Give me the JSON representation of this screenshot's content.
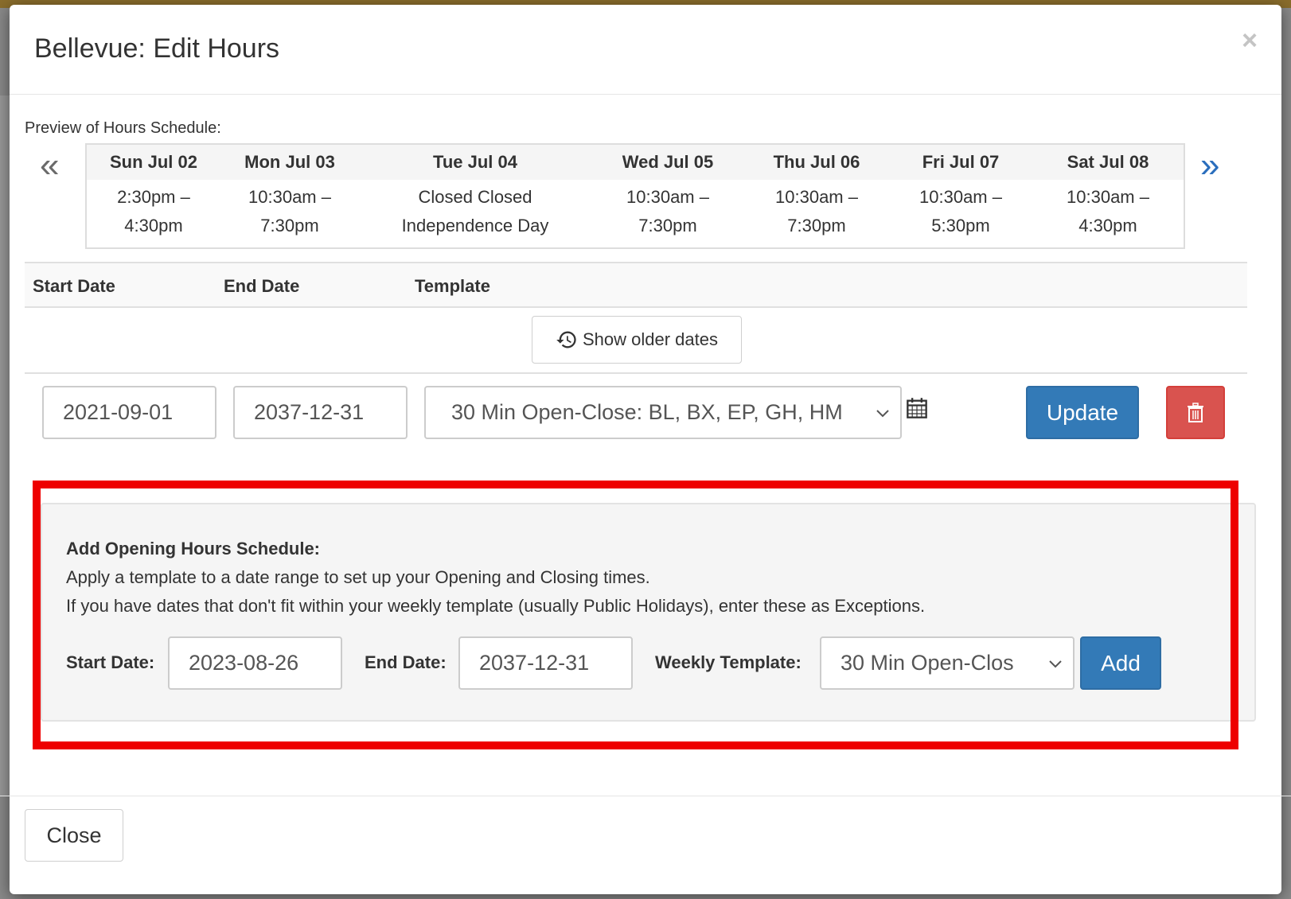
{
  "modal": {
    "title": "Bellevue: Edit Hours",
    "close_symbol": "×"
  },
  "preview": {
    "label": "Preview of Hours Schedule:",
    "prev_arrow": "«",
    "next_arrow": "»",
    "days": [
      {
        "day": "Sun Jul 02",
        "line1": "2:30pm –",
        "line2": "4:30pm"
      },
      {
        "day": "Mon Jul 03",
        "line1": "10:30am –",
        "line2": "7:30pm"
      },
      {
        "day": "Tue Jul 04",
        "line1": "Closed Closed",
        "line2": "Independence Day"
      },
      {
        "day": "Wed Jul 05",
        "line1": "10:30am –",
        "line2": "7:30pm"
      },
      {
        "day": "Thu Jul 06",
        "line1": "10:30am –",
        "line2": "7:30pm"
      },
      {
        "day": "Fri Jul 07",
        "line1": "10:30am –",
        "line2": "5:30pm"
      },
      {
        "day": "Sat Jul 08",
        "line1": "10:30am –",
        "line2": "4:30pm"
      }
    ]
  },
  "schedule_table": {
    "headers": {
      "start_date": "Start Date",
      "end_date": "End Date",
      "template": "Template"
    },
    "show_older_label": "Show older dates",
    "row": {
      "start_date": "2021-09-01",
      "end_date": "2037-12-31",
      "template": "30 Min Open-Close: BL, BX, EP, GH, HM",
      "update_label": "Update"
    }
  },
  "add_panel": {
    "title": "Add Opening Hours Schedule:",
    "line1": "Apply a template to a date range to set up your Opening and Closing times.",
    "line2": "If you have dates that don't fit within your weekly template (usually Public Holidays), enter these as Exceptions.",
    "start_label": "Start Date:",
    "start_value": "2023-08-26",
    "end_label": "End Date:",
    "end_value": "2037-12-31",
    "template_label": "Weekly Template:",
    "template_value": "30 Min Open-Clos",
    "add_label": "Add"
  },
  "footer": {
    "close_label": "Close"
  },
  "colors": {
    "primary": "#337ab7",
    "danger": "#d9534f",
    "highlight": "#ee0000"
  }
}
